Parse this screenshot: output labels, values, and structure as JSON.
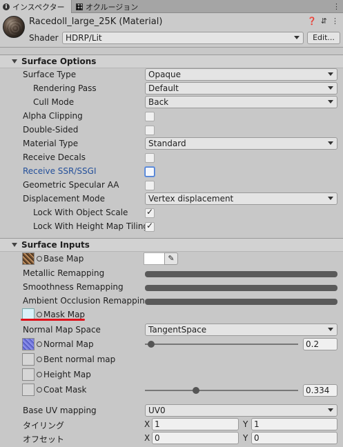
{
  "tabs": [
    {
      "label": "インスペクター",
      "icon": "info-icon"
    },
    {
      "label": "オクルージョン",
      "icon": "grid-icon"
    }
  ],
  "header": {
    "title": "Racedoll_large_25K (Material)",
    "shader_label": "Shader",
    "shader_value": "HDRP/Lit",
    "edit_label": "Edit...",
    "icons": [
      "help-icon",
      "preset-icon",
      "menu-icon"
    ]
  },
  "surface_options": {
    "title": "Surface Options",
    "surface_type": {
      "label": "Surface Type",
      "value": "Opaque"
    },
    "rendering_pass": {
      "label": "Rendering Pass",
      "value": "Default"
    },
    "cull_mode": {
      "label": "Cull Mode",
      "value": "Back"
    },
    "alpha_clipping": {
      "label": "Alpha Clipping",
      "checked": false
    },
    "double_sided": {
      "label": "Double-Sided",
      "checked": false
    },
    "material_type": {
      "label": "Material Type",
      "value": "Standard"
    },
    "receive_decals": {
      "label": "Receive Decals",
      "checked": false
    },
    "receive_ssr": {
      "label": "Receive SSR/SSGI",
      "checked": false
    },
    "geometric_specular": {
      "label": "Geometric Specular AA",
      "checked": false
    },
    "displacement_mode": {
      "label": "Displacement Mode",
      "value": "Vertex displacement"
    },
    "lock_object_scale": {
      "label": "Lock With Object Scale",
      "checked": true
    },
    "lock_height_tiling": {
      "label": "Lock With Height Map Tiling",
      "checked": true
    }
  },
  "surface_inputs": {
    "title": "Surface Inputs",
    "base_map": {
      "label": "Base Map"
    },
    "metallic_remapping": {
      "label": "Metallic Remapping"
    },
    "smoothness_remapping": {
      "label": "Smoothness Remapping"
    },
    "ao_remapping": {
      "label": "Ambient Occlusion Remapping"
    },
    "mask_map": {
      "label": "Mask Map"
    },
    "normal_map_space": {
      "label": "Normal Map Space",
      "value": "TangentSpace"
    },
    "normal_map": {
      "label": "Normal Map",
      "value": "0.2",
      "fraction": 0.02
    },
    "bent_normal_map": {
      "label": "Bent normal map"
    },
    "height_map": {
      "label": "Height Map"
    },
    "coat_mask": {
      "label": "Coat Mask",
      "value": "0.334",
      "fraction": 0.334
    },
    "base_uv_mapping": {
      "label": "Base UV mapping",
      "value": "UV0"
    },
    "tiling": {
      "label": "タイリング",
      "x_label": "X",
      "x": "1",
      "y_label": "Y",
      "y": "1"
    },
    "offset": {
      "label": "オフセット",
      "x_label": "X",
      "x": "0",
      "y_label": "Y",
      "y": "0"
    }
  }
}
